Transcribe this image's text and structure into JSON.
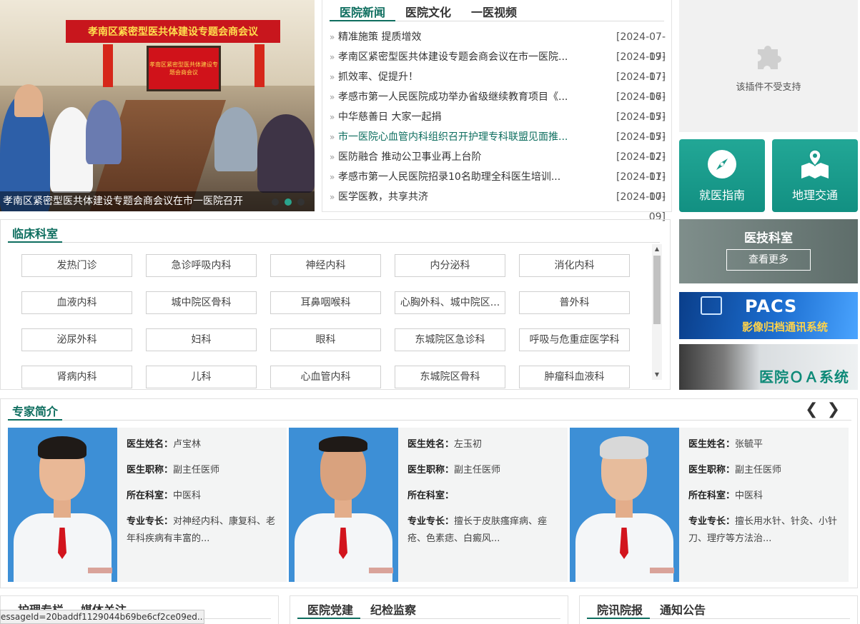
{
  "banner": {
    "board_title": "孝南区紧密型医共体建设专题会商会议",
    "screen_text": "孝南区紧密型医共体建设专题会商会议",
    "caption": "孝南区紧密型医共体建设专题会商会议在市一医院召开"
  },
  "news": {
    "tabs": [
      "医院新闻",
      "医院文化",
      "一医视频"
    ],
    "items": [
      {
        "title": "精准施策 提质增效",
        "date": "[2024-07-19]"
      },
      {
        "title": "孝南区紧密型医共体建设专题会商会议在市一医院...",
        "date": "[2024-07-17]"
      },
      {
        "title": "抓效率、促提升！",
        "date": "[2024-07-16]"
      },
      {
        "title": "孝感市第一人民医院成功举办省级继续教育项目《...",
        "date": "[2024-07-15]"
      },
      {
        "title": "中华慈善日 大家一起捐",
        "date": "[2024-07-15]"
      },
      {
        "title": "市一医院心血管内科组织召开护理专科联盟见面推...",
        "date": "[2024-07-12]"
      },
      {
        "title": "医防融合 推动公卫事业再上台阶",
        "date": "[2024-07-11]"
      },
      {
        "title": "孝感市第一人民医院招录10名助理全科医生培训...",
        "date": "[2024-07-10]"
      },
      {
        "title": "医学医教，共享共济",
        "date": "[2024-07-09]"
      }
    ]
  },
  "plugin": {
    "message": "该插件不受支持"
  },
  "quick": {
    "guide_label": "就医指南",
    "traffic_label": "地理交通"
  },
  "yiji": {
    "title": "医技科室",
    "more": "查看更多"
  },
  "pacs": {
    "big": "PACS",
    "sub": "影像归档通讯系统"
  },
  "oa": {
    "title": "医院ＯＡ系统"
  },
  "clinic": {
    "title": "临床科室",
    "departments": [
      "发热门诊",
      "急诊呼吸内科",
      "神经内科",
      "内分泌科",
      "消化内科",
      "血液内科",
      "城中院区骨科",
      "耳鼻咽喉科",
      "心胸外科、城中院区...",
      "普外科",
      "泌尿外科",
      "妇科",
      "眼科",
      "东城院区急诊科",
      "呼吸与危重症医学科",
      "肾病内科",
      "儿科",
      "心血管内科",
      "东城院区骨科",
      "肿瘤科血液科"
    ]
  },
  "experts": {
    "title": "专家简介",
    "labels": {
      "name": "医生姓名：",
      "title": "医生职称：",
      "dept": "所在科室：",
      "spec": "专业专长："
    },
    "cards": [
      {
        "name": "卢宝林",
        "title": "副主任医师",
        "dept": "中医科",
        "spec": "对神经内科、康复科、老年科疾病有丰富的..."
      },
      {
        "name": "左玉初",
        "title": "副主任医师",
        "dept": "",
        "spec": "擅长于皮肤瘙痒病、痤疮、色素痣、白癜风..."
      },
      {
        "name": "张毓平",
        "title": "副主任医师",
        "dept": "中医科",
        "spec": "擅长用水针、针灸、小针刀、理疗等方法治..."
      }
    ]
  },
  "bottom": {
    "left_tabs": [
      "护理专栏",
      "媒体关注"
    ],
    "middle_tabs": [
      "医院党建",
      "纪检监察"
    ],
    "right_tabs": [
      "院讯院报",
      "通知公告"
    ]
  },
  "status_bar": "essageId=20baddf1129044b69be6cf2ce09ed..."
}
